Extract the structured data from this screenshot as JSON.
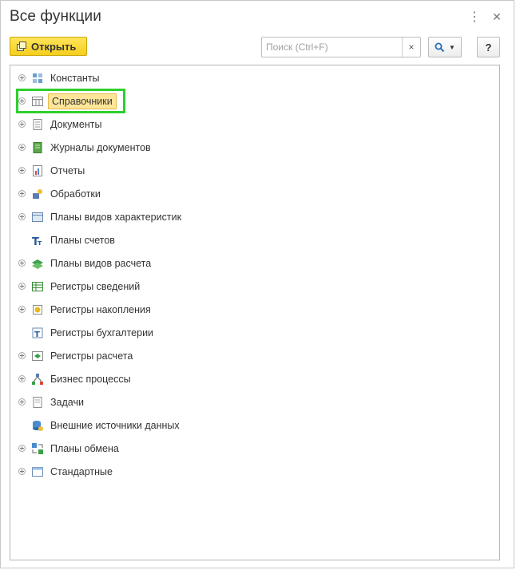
{
  "window": {
    "title": "Все функции",
    "more_glyph": "⋮",
    "close_glyph": "✕"
  },
  "toolbar": {
    "open_label": "Открыть",
    "search_placeholder": "Поиск (Ctrl+F)",
    "search_value": "",
    "clear_glyph": "×",
    "help_label": "?"
  },
  "colors": {
    "accent_yellow": "#f5cf1f",
    "selection": "#fde59a",
    "highlight_frame": "#2fcf2f"
  },
  "tree": {
    "items": [
      {
        "label": "Константы",
        "icon": "constants-icon",
        "expandable": true
      },
      {
        "label": "Справочники",
        "icon": "catalogs-icon",
        "expandable": true,
        "selected": true
      },
      {
        "label": "Документы",
        "icon": "documents-icon",
        "expandable": true
      },
      {
        "label": "Журналы документов",
        "icon": "document-journals-icon",
        "expandable": true
      },
      {
        "label": "Отчеты",
        "icon": "reports-icon",
        "expandable": true
      },
      {
        "label": "Обработки",
        "icon": "data-processors-icon",
        "expandable": true
      },
      {
        "label": "Планы видов характеристик",
        "icon": "characteristic-types-icon",
        "expandable": true
      },
      {
        "label": "Планы счетов",
        "icon": "chart-of-accounts-icon",
        "expandable": false
      },
      {
        "label": "Планы видов расчета",
        "icon": "calculation-types-icon",
        "expandable": true
      },
      {
        "label": "Регистры сведений",
        "icon": "information-registers-icon",
        "expandable": true
      },
      {
        "label": "Регистры накопления",
        "icon": "accumulation-registers-icon",
        "expandable": true
      },
      {
        "label": "Регистры бухгалтерии",
        "icon": "accounting-registers-icon",
        "expandable": false
      },
      {
        "label": "Регистры расчета",
        "icon": "calculation-registers-icon",
        "expandable": true
      },
      {
        "label": "Бизнес процессы",
        "icon": "business-processes-icon",
        "expandable": true
      },
      {
        "label": "Задачи",
        "icon": "tasks-icon",
        "expandable": true
      },
      {
        "label": "Внешние источники данных",
        "icon": "external-data-sources-icon",
        "expandable": false
      },
      {
        "label": "Планы обмена",
        "icon": "exchange-plans-icon",
        "expandable": true
      },
      {
        "label": "Стандартные",
        "icon": "standard-icon",
        "expandable": true
      }
    ]
  }
}
